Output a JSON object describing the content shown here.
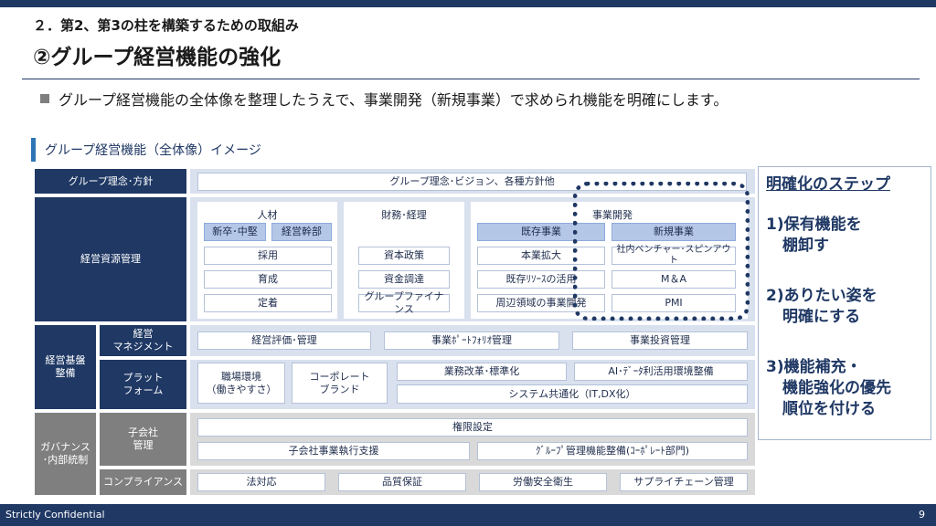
{
  "header": {
    "subtitle": "２．第2、第3の柱を構築するための取組み",
    "title": "②グループ経営機能の強化",
    "bullet": "グループ経営機能の全体像を整理したうえで、事業開発（新規事業）で求められ機能を明確にします。"
  },
  "diagram": {
    "heading": "グループ経営機能（全体像）イメージ",
    "row_philosophy": {
      "label": "グループ理念･方針",
      "content": "グループ理念･ビジョン、各種方針他"
    },
    "row_resources": {
      "label": "経営資源管理",
      "hr": {
        "title": "人材",
        "items": [
          "新卒･中堅",
          "経営幹部",
          "採用",
          "育成",
          "定着"
        ]
      },
      "finance": {
        "title": "財務･経理",
        "items": [
          "資本政策",
          "資金調達",
          "グループファイナンス"
        ]
      },
      "bizdev": {
        "title": "事業開発",
        "existing_header": "既存事業",
        "new_header": "新規事業",
        "existing_items": [
          "本業拡大",
          "既存ﾘｿｰｽの活用",
          "周辺領域の事業開発"
        ],
        "new_items": [
          "社内ベンチャー･スピンアウト",
          "M＆A",
          "PMI"
        ]
      }
    },
    "row_foundation": {
      "label": "経営基盤\n整備",
      "management": {
        "label": "経営\nマネジメント",
        "items": [
          "経営評価･管理",
          "事業ﾎﾟｰﾄﾌｫﾘｵ管理",
          "事業投資管理"
        ]
      },
      "platform": {
        "label": "プラット\nフォーム",
        "items": [
          "職場環境\n（働きやすさ）",
          "コーポレート\nブランド",
          "業務改革･標準化",
          "AI･ﾃﾞｰﾀ利活用環境整備",
          "システム共通化（IT,DX化）"
        ]
      }
    },
    "row_governance": {
      "label": "ガバナンス\n･内部統制",
      "subsidiary": {
        "label": "子会社\n管理",
        "items": [
          "権限設定",
          "子会社事業執行支援",
          "ｸﾞﾙｰﾌﾟ管理機能整備(ｺｰﾎﾟﾚｰﾄ部門)"
        ]
      },
      "compliance": {
        "label": "コンプライアンス",
        "items": [
          "法対応",
          "品質保証",
          "労働安全衛生",
          "サプライチェーン管理"
        ]
      }
    }
  },
  "steps": {
    "title": "明確化のステップ",
    "items": [
      {
        "line1": "1)保有機能を",
        "line2": "棚卸す"
      },
      {
        "line1": "2)ありたい姿を",
        "line2": "明確にする"
      },
      {
        "line1": "3)機能補充・",
        "line2": "機能強化の優先\n順位を付ける"
      }
    ]
  },
  "footer": {
    "confidential": "Strictly Confidential",
    "page_number": "9"
  },
  "colors": {
    "navy": "#1f3864",
    "accent_blue": "#2e75b6",
    "light_panel": "#d9e1ee",
    "gray": "#7f7f7f"
  }
}
